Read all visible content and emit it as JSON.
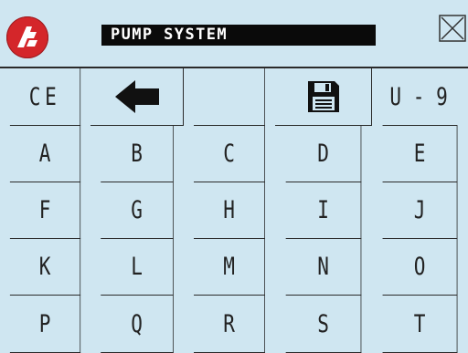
{
  "header": {
    "title": "PUMP SYSTEM",
    "logo_icon": "logo-icon",
    "close_icon": "close-icon"
  },
  "keypad": {
    "row1": {
      "clear_label": "CE",
      "back_icon": "left-arrow-icon",
      "blank_label": "",
      "save_icon": "floppy-disk-icon",
      "range_label": "U - 9"
    },
    "letters": [
      "A",
      "B",
      "C",
      "D",
      "E",
      "F",
      "G",
      "H",
      "I",
      "J",
      "K",
      "L",
      "M",
      "N",
      "O",
      "P",
      "Q",
      "R",
      "S",
      "T"
    ]
  },
  "colors": {
    "background": "#cfe6f1",
    "title_bar": "#0a0a0a",
    "logo": "#d4262a",
    "grid_line": "#2a2a2a"
  }
}
